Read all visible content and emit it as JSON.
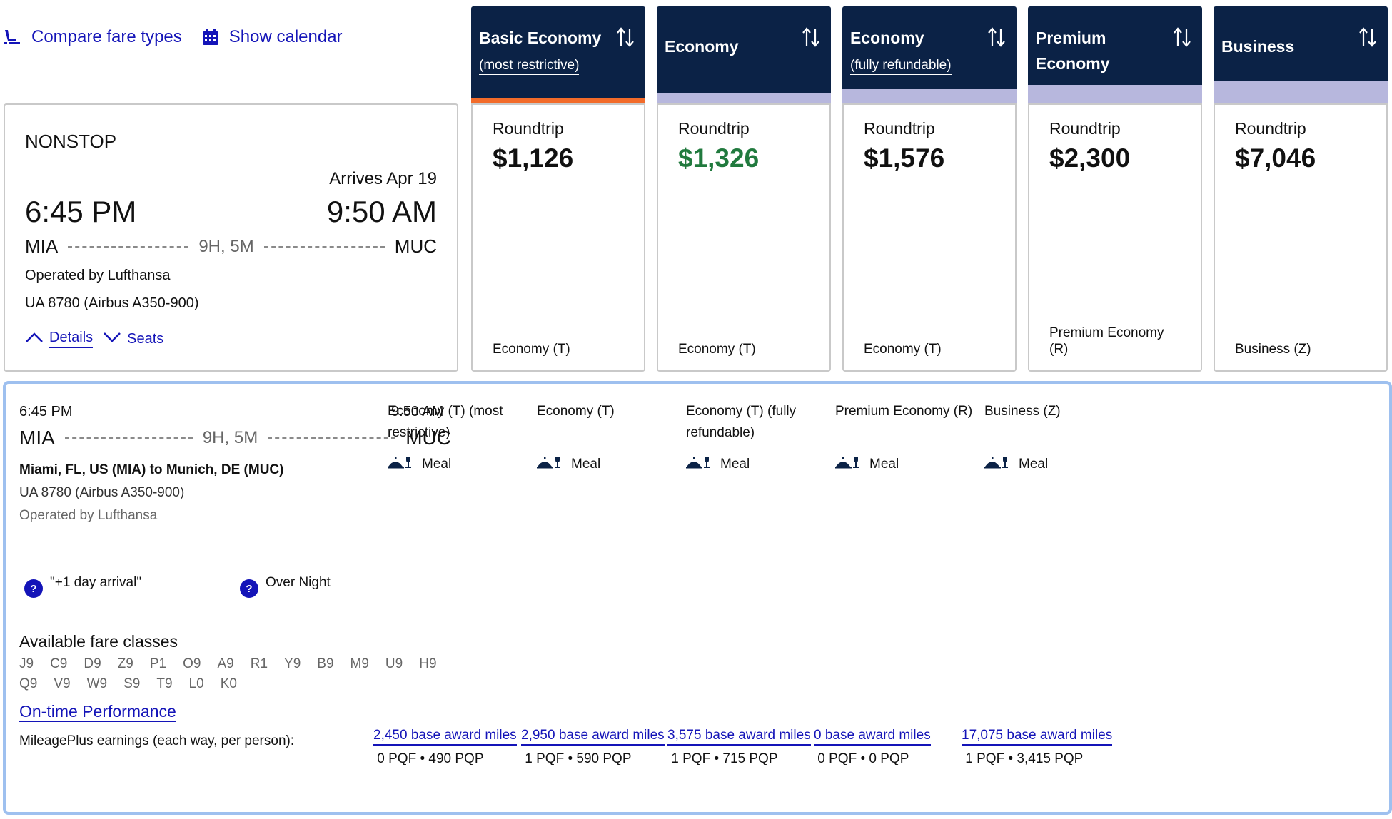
{
  "toolbar": {
    "compare_label": "Compare fare types",
    "calendar_label": "Show calendar"
  },
  "flight": {
    "stops": "NONSTOP",
    "arrives_label": "Arrives Apr 19",
    "depart_time": "6:45 PM",
    "arrive_time": "9:50 AM",
    "origin": "MIA",
    "destination": "MUC",
    "duration": "9H, 5M",
    "operated_by": "Operated by Lufthansa",
    "flight_number": "UA 8780 (Airbus A350-900)",
    "details_label": "Details",
    "seats_label": "Seats"
  },
  "fares": [
    {
      "title": "Basic Economy",
      "subtitle": "(most restrictive)",
      "strip_color": "#f26b2a",
      "trip_label": "Roundtrip",
      "price": "$1,126",
      "price_color": "#111111",
      "cabin": "Economy (T)",
      "detail_name": "Economy (T) (most restrictive)",
      "meal": "Meal",
      "miles": "2,450 base award miles",
      "pqf": "0 PQF",
      "pqp": "490 PQP"
    },
    {
      "title": "Economy",
      "subtitle": "",
      "strip_color": "#b7b7dd",
      "trip_label": "Roundtrip",
      "price": "$1,326",
      "price_color": "#217a3e",
      "cabin": "Economy (T)",
      "detail_name": "Economy (T)",
      "meal": "Meal",
      "miles": "2,950 base award miles",
      "pqf": "1 PQF",
      "pqp": "590 PQP"
    },
    {
      "title": "Economy",
      "subtitle": "(fully refundable)",
      "strip_color": "#b7b7dd",
      "trip_label": "Roundtrip",
      "price": "$1,576",
      "price_color": "#111111",
      "cabin": "Economy (T)",
      "detail_name": "Economy (T) (fully refundable)",
      "meal": "Meal",
      "miles": "3,575 base award miles",
      "pqf": "1 PQF",
      "pqp": "715 PQP"
    },
    {
      "title": "Premium Economy",
      "subtitle": "",
      "strip_color": "#b7b7dd",
      "trip_label": "Roundtrip",
      "price": "$2,300",
      "price_color": "#111111",
      "cabin": "Premium Economy (R)",
      "detail_name": "Premium Economy (R)",
      "meal": "Meal",
      "miles": "0 base award miles",
      "pqf": "0 PQF",
      "pqp": "0 PQP"
    },
    {
      "title": "Business",
      "subtitle": "",
      "strip_color": "#b7b7dd",
      "trip_label": "Roundtrip",
      "price": "$7,046",
      "price_color": "#111111",
      "cabin": "Business (Z)",
      "detail_name": "Business (Z)",
      "meal": "Meal",
      "miles": "17,075 base award miles",
      "pqf": "1 PQF",
      "pqp": "3,415 PQP"
    }
  ],
  "details": {
    "depart_time": "6:45 PM",
    "arrive_time": "9:50 AM",
    "origin": "MIA",
    "destination": "MUC",
    "duration": "9H, 5M",
    "cities": "Miami, FL, US (MIA) to Munich, DE (MUC)",
    "flight_number": "UA 8780 (Airbus A350-900)",
    "operated_by": "Operated by Lufthansa",
    "note_arrival": "\"+1 day arrival\"",
    "note_overnight": "Over Night",
    "fare_classes_title": "Available fare classes",
    "fare_classes": [
      "J9",
      "C9",
      "D9",
      "Z9",
      "P1",
      "O9",
      "A9",
      "R1",
      "Y9",
      "B9",
      "M9",
      "U9",
      "H9",
      "Q9",
      "V9",
      "W9",
      "S9",
      "T9",
      "L0",
      "K0"
    ],
    "ontime_label": "On-time Performance",
    "mileageplus_label": "MileagePlus earnings (each way, per person):"
  },
  "colors": {
    "header_navy": "#0b2246",
    "link_blue": "#1414b8",
    "selected_orange": "#f26b2a",
    "unselected_lavender": "#b7b7dd",
    "price_green": "#217a3e",
    "panel_border": "#9ec0ef"
  },
  "icons": [
    "seat-icon",
    "calendar-icon",
    "sort-icon",
    "chevron-up-icon",
    "chevron-down-icon",
    "question-icon",
    "meal-icon"
  ]
}
